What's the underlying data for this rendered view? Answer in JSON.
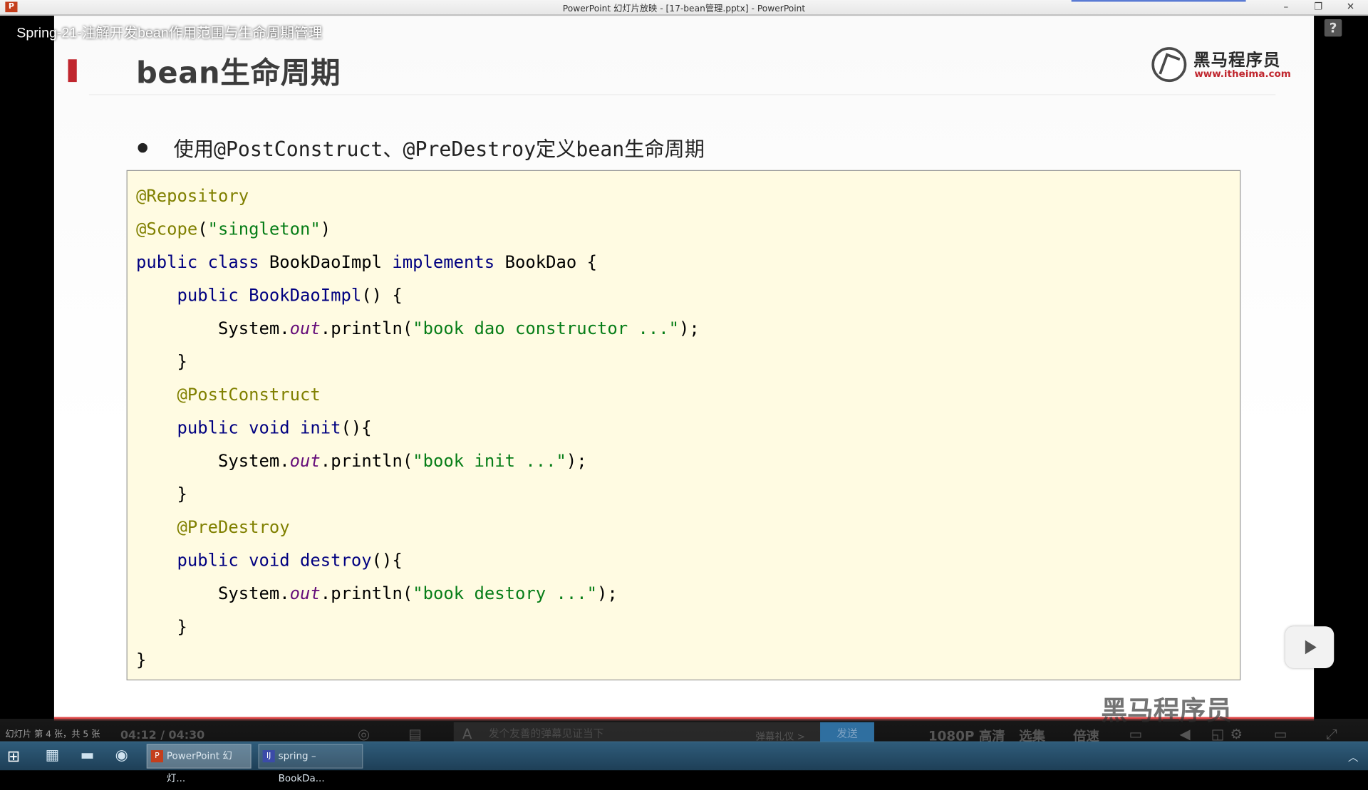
{
  "window": {
    "title": "PowerPoint 幻灯片放映 - [17-bean管理.pptx] - PowerPoint",
    "app_icon": "P",
    "controls": [
      "–",
      "❐",
      "✕"
    ]
  },
  "video": {
    "title": "Spring-21-注解开发bean作用范围与生命周期管理",
    "help": "?"
  },
  "slide": {
    "heading": "bean生命周期",
    "logo": {
      "name_cn": "黑马程序员",
      "url": "www.itheima.com"
    },
    "bullet": "使用@PostConstruct、@PreDestroy定义bean生命周期",
    "code_lines": [
      [
        {
          "t": "@Repository",
          "c": "ann"
        }
      ],
      [
        {
          "t": "@Scope",
          "c": "ann"
        },
        {
          "t": "(",
          "c": "cls"
        },
        {
          "t": "\"singleton\"",
          "c": "str"
        },
        {
          "t": ")",
          "c": "cls"
        }
      ],
      [
        {
          "t": "public class ",
          "c": "kw"
        },
        {
          "t": "BookDaoImpl ",
          "c": "cls"
        },
        {
          "t": "implements ",
          "c": "kw"
        },
        {
          "t": "BookDao {",
          "c": "cls"
        }
      ],
      [
        {
          "t": "    public ",
          "c": "kw"
        },
        {
          "t": "BookDaoImpl",
          "c": "kw"
        },
        {
          "t": "() {",
          "c": "cls"
        }
      ],
      [
        {
          "t": "        System.",
          "c": "cls"
        },
        {
          "t": "out",
          "c": "fld"
        },
        {
          "t": ".println(",
          "c": "cls"
        },
        {
          "t": "\"book dao constructor ...\"",
          "c": "str"
        },
        {
          "t": ");",
          "c": "cls"
        }
      ],
      [
        {
          "t": "    }",
          "c": "cls"
        }
      ],
      [
        {
          "t": "    @PostConstruct",
          "c": "ann"
        }
      ],
      [
        {
          "t": "    public void ",
          "c": "kw"
        },
        {
          "t": "init",
          "c": "kw"
        },
        {
          "t": "(){",
          "c": "cls"
        }
      ],
      [
        {
          "t": "        System.",
          "c": "cls"
        },
        {
          "t": "out",
          "c": "fld"
        },
        {
          "t": ".println(",
          "c": "cls"
        },
        {
          "t": "\"book init ...\"",
          "c": "str"
        },
        {
          "t": ");",
          "c": "cls"
        }
      ],
      [
        {
          "t": "    }",
          "c": "cls"
        }
      ],
      [
        {
          "t": "    @PreDestroy",
          "c": "ann"
        }
      ],
      [
        {
          "t": "    public void ",
          "c": "kw"
        },
        {
          "t": "destroy",
          "c": "kw"
        },
        {
          "t": "(){",
          "c": "cls"
        }
      ],
      [
        {
          "t": "        System.",
          "c": "cls"
        },
        {
          "t": "out",
          "c": "fld"
        },
        {
          "t": ".println(",
          "c": "cls"
        },
        {
          "t": "\"book destory ...\"",
          "c": "str"
        },
        {
          "t": ");",
          "c": "cls"
        }
      ],
      [
        {
          "t": "    }",
          "c": "cls"
        }
      ],
      [
        {
          "t": "}",
          "c": "cls"
        }
      ]
    ]
  },
  "player": {
    "slide_info": "幻灯片 第 4 张，共 5 张",
    "time": "04:12 / 04:30",
    "danmaku_placeholder": "发个友善的弹幕见证当下",
    "etiquette": "弹幕礼仪 >",
    "send": "发送",
    "quality": "1080P 高清",
    "episodes": "选集",
    "speed": "倍速",
    "watermark": "黑马程序员"
  },
  "taskbar": {
    "tasks": [
      {
        "label": "PowerPoint 幻灯...",
        "icon": "P",
        "color": "#c43e1c"
      },
      {
        "label": "spring – BookDa...",
        "icon": "IJ",
        "color": "#3b4ba8"
      }
    ]
  }
}
